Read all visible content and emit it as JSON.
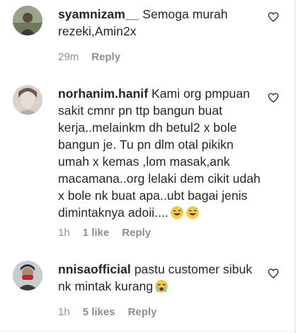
{
  "comments": [
    {
      "username": "syamnizam__",
      "text": "Semoga murah rezeki,Amin2x",
      "time": "29m",
      "likes": "",
      "reply_label": "Reply",
      "emojis": []
    },
    {
      "username": "norhanim.hanif",
      "text": "Kami org pmpuan sakit cmnr pn ttp bangun buat kerja..melainkm dh betul2 x bole bangun je. Tu pn dlm otal pikikn umah x kemas ,lom masak,ank macamana..org lelaki dem cikit udah x bole nk buat apa..ubt bagai jenis dimintaknya adoii....",
      "time": "1h",
      "likes": "1 like",
      "reply_label": "Reply",
      "emojis": [
        "sweat-smile-emoji",
        "sweat-smile-emoji"
      ]
    },
    {
      "username": "nnisaofficial",
      "text": "pastu customer sibuk nk mintak kurang",
      "time": "1h",
      "likes": "5 likes",
      "reply_label": "Reply",
      "emojis": [
        "crying-emoji"
      ]
    }
  ],
  "icons": {
    "like": "heart-outline-icon"
  },
  "colors": {
    "text": "#262626",
    "meta": "#8e8e8e"
  }
}
